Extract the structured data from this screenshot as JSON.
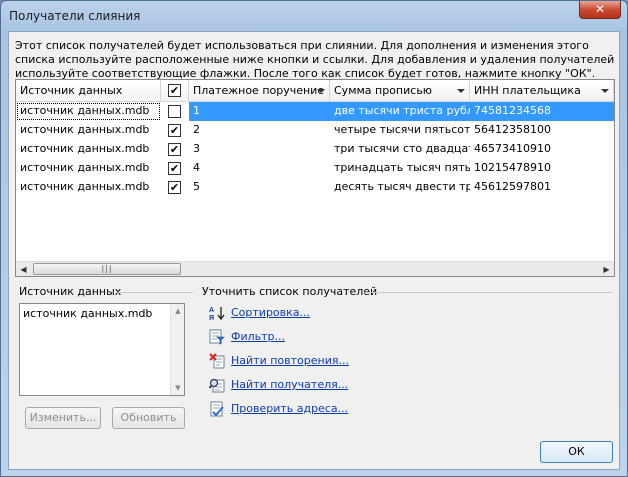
{
  "window": {
    "title": "Получатели слияния",
    "close_label": "✕"
  },
  "intro": "Этот список получателей будет использоваться при слиянии. Для дополнения и изменения этого списка используйте расположенные ниже кнопки и ссылки. Для добавления и удаления получателей используйте соответствующие флажки. После того как список будет готов, нажмите кнопку \"ОК\".",
  "table": {
    "headers": [
      "Источник данных",
      "",
      "Платежное поручение",
      "Сумма прописью",
      "ИНН плательщика"
    ],
    "rows": [
      {
        "source": "источник данных.mdb",
        "checked": "✔",
        "num": "1",
        "sum": "две тысячи триста рубл",
        "inn": "74581234568",
        "selected": true
      },
      {
        "source": "источник данных.mdb",
        "checked": "✔",
        "num": "2",
        "sum": "четыре тысячи пятьсот",
        "inn": "56412358100"
      },
      {
        "source": "источник данных.mdb",
        "checked": "✔",
        "num": "3",
        "sum": "три тысячи сто двадцать",
        "inn": "46573410910"
      },
      {
        "source": "источник данных.mdb",
        "checked": "✔",
        "num": "4",
        "sum": "тринадцать тысяч пятьсот",
        "inn": "10215478910"
      },
      {
        "source": "источник данных.mdb",
        "checked": "✔",
        "num": "5",
        "sum": "десять тысяч двести три",
        "inn": "45612597801"
      }
    ]
  },
  "datasource": {
    "label": "Источник данных",
    "items": [
      "источник данных.mdb"
    ],
    "edit_label": "Изменить...",
    "refresh_label": "Обновить"
  },
  "refine": {
    "label": "Уточнить список получателей",
    "links": [
      {
        "label": "Сортировка...",
        "icon": "sort-az-icon"
      },
      {
        "label": "Фильтр...",
        "icon": "filter-icon"
      },
      {
        "label": "Найти повторения...",
        "icon": "find-duplicates-icon"
      },
      {
        "label": "Найти получателя...",
        "icon": "find-recipient-icon"
      },
      {
        "label": "Проверить адреса...",
        "icon": "validate-addresses-icon"
      }
    ]
  },
  "ok_label": "ОК"
}
